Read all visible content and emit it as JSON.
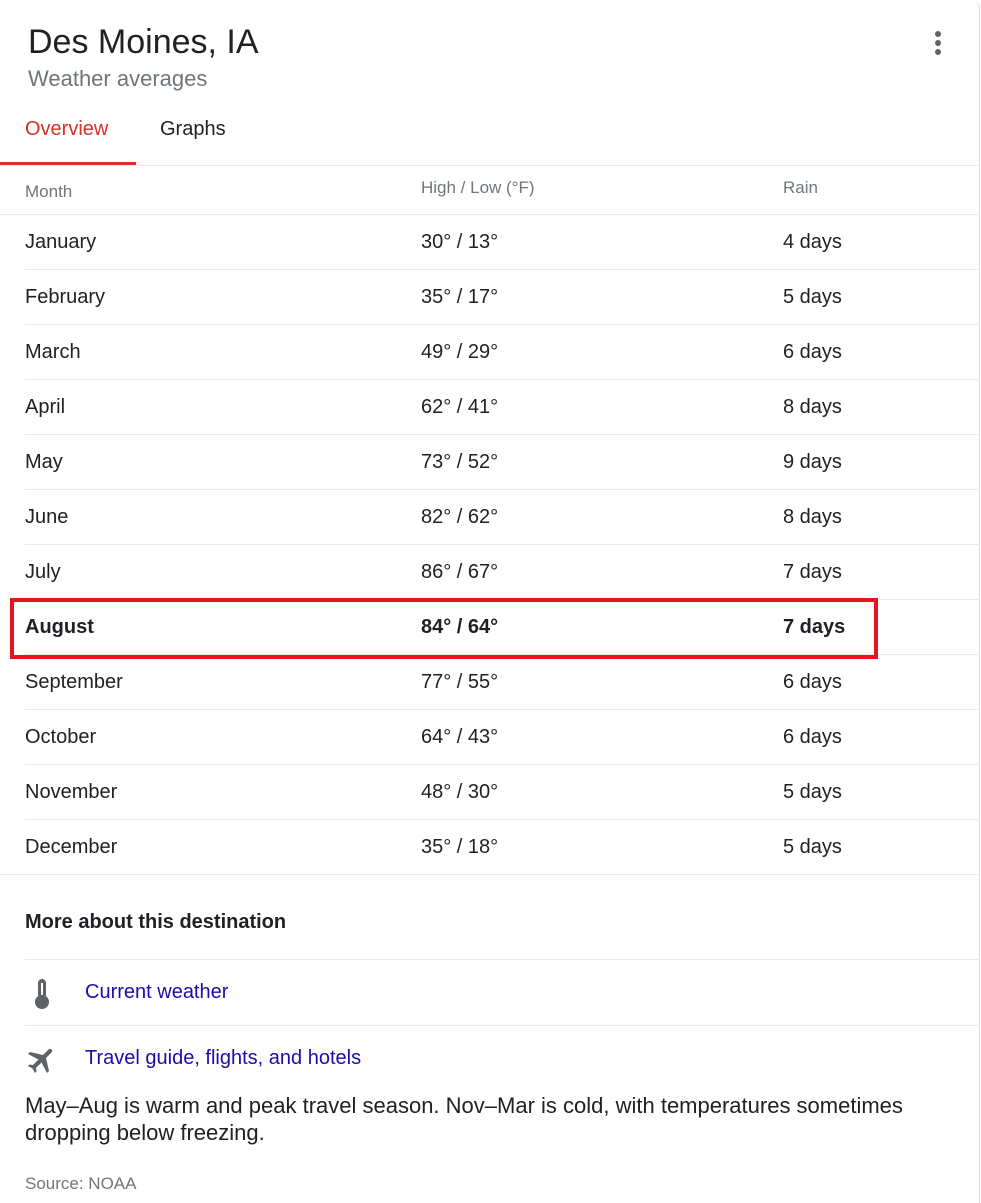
{
  "header": {
    "title": "Des Moines, IA",
    "subtitle": "Weather averages"
  },
  "tabs": [
    {
      "label": "Overview",
      "active": true
    },
    {
      "label": "Graphs",
      "active": false
    }
  ],
  "table": {
    "headers": {
      "month": "Month",
      "temp": "High / Low  (°F)",
      "rain": "Rain"
    },
    "rows": [
      {
        "month": "January",
        "temp": "30° / 13°",
        "rain": "4 days"
      },
      {
        "month": "February",
        "temp": "35° / 17°",
        "rain": "5 days"
      },
      {
        "month": "March",
        "temp": "49° / 29°",
        "rain": "6 days"
      },
      {
        "month": "April",
        "temp": "62° / 41°",
        "rain": "8 days"
      },
      {
        "month": "May",
        "temp": "73° / 52°",
        "rain": "9 days"
      },
      {
        "month": "June",
        "temp": "82° / 62°",
        "rain": "8 days"
      },
      {
        "month": "July",
        "temp": "86° / 67°",
        "rain": "7 days"
      },
      {
        "month": "August",
        "temp": "84° / 64°",
        "rain": "7 days",
        "current": true
      },
      {
        "month": "September",
        "temp": "77° / 55°",
        "rain": "6 days"
      },
      {
        "month": "October",
        "temp": "64° / 43°",
        "rain": "6 days"
      },
      {
        "month": "November",
        "temp": "48° / 30°",
        "rain": "5 days"
      },
      {
        "month": "December",
        "temp": "35° / 18°",
        "rain": "5 days"
      }
    ]
  },
  "more": {
    "title": "More about this destination",
    "links": [
      {
        "label": "Current weather",
        "icon": "thermometer-icon"
      },
      {
        "label": "Travel guide, flights, and hotels",
        "icon": "airplane-icon"
      }
    ]
  },
  "description": "May–Aug is warm and peak travel season. Nov–Mar is cold, with temperatures sometimes dropping below freezing.",
  "source": "Source: NOAA",
  "colors": {
    "accent": "#d93025",
    "link": "#1a0dab",
    "highlight_box": "#e3151e",
    "muted": "#70757a"
  }
}
